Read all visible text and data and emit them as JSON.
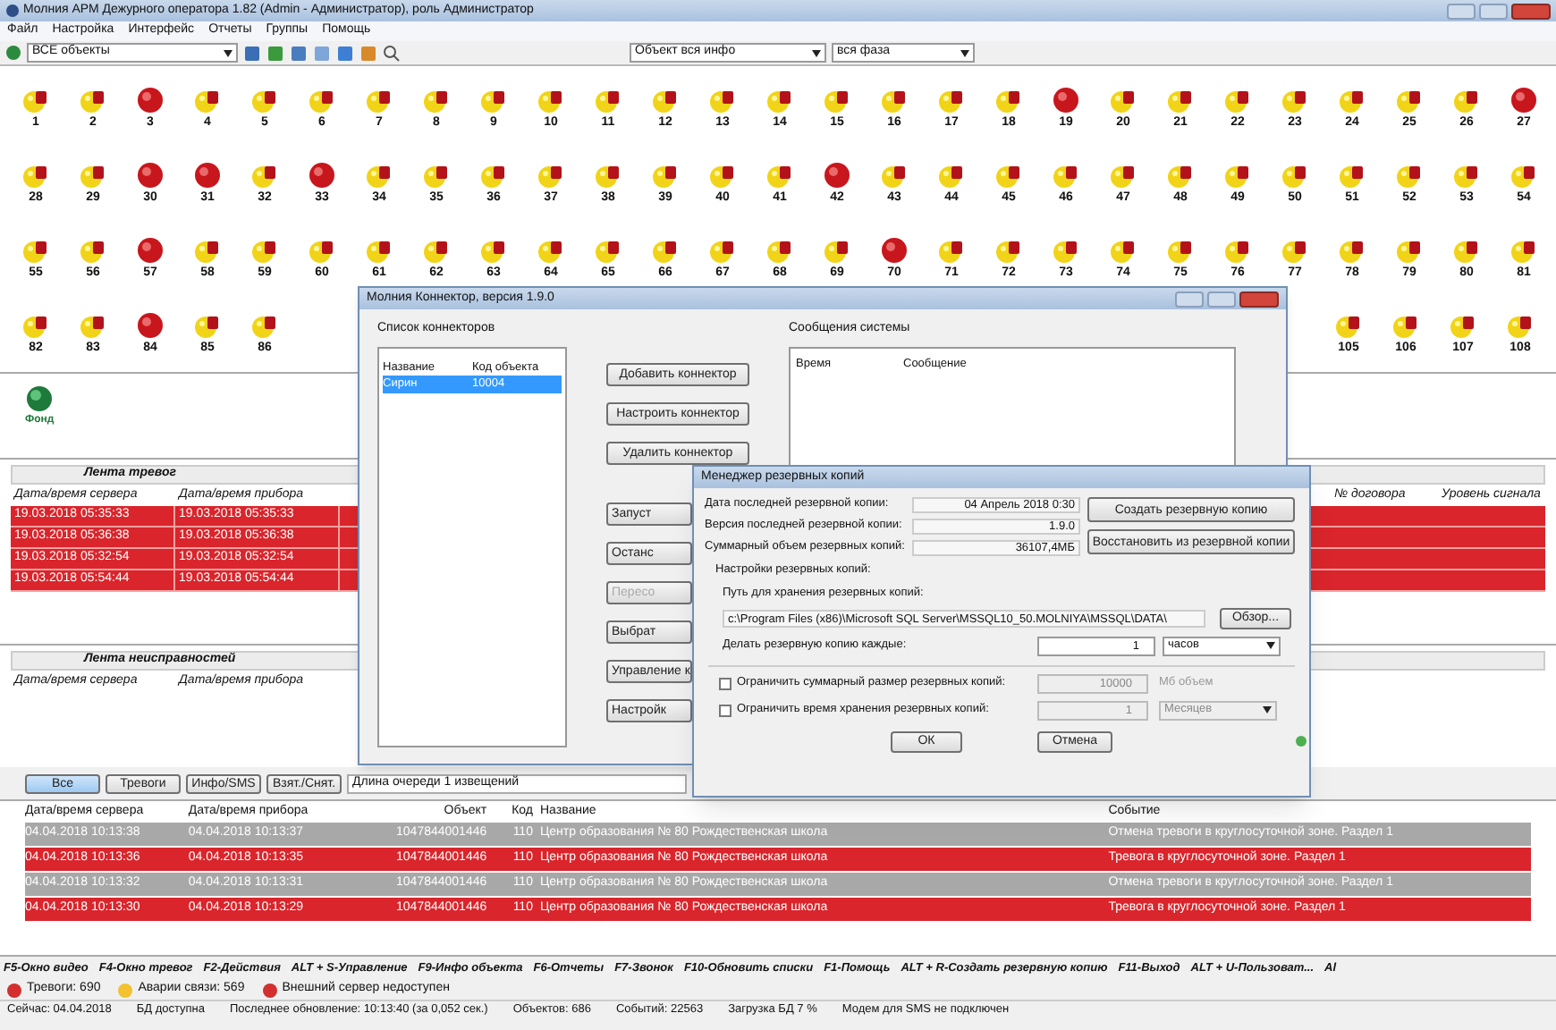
{
  "window": {
    "title": "Молния АРМ Дежурного оператора 1.82 (Admin - Администратор), роль Администратор"
  },
  "menu": [
    "Файл",
    "Настройка",
    "Интерфейс",
    "Отчеты",
    "Группы",
    "Помощь"
  ],
  "toolbar": {
    "objects_filter": "ВСЕ объекты",
    "info_filter": "Объект вся инфо",
    "phase_filter": "вся фаза"
  },
  "object_rows": [
    {
      "left": [
        {
          "label": "1",
          "alarm": false
        },
        {
          "label": "2",
          "alarm": false
        },
        {
          "label": "3",
          "alarm": true
        },
        {
          "label": "4",
          "alarm": false
        },
        {
          "label": "5",
          "alarm": false
        },
        {
          "label": "6",
          "alarm": false
        },
        {
          "label": "7",
          "alarm": false
        },
        {
          "label": "8",
          "alarm": false
        },
        {
          "label": "9",
          "alarm": false
        },
        {
          "label": "10",
          "alarm": false
        },
        {
          "label": "11",
          "alarm": false
        },
        {
          "label": "12",
          "alarm": false
        },
        {
          "label": "13",
          "alarm": false
        },
        {
          "label": "14",
          "alarm": false
        },
        {
          "label": "15",
          "alarm": false
        },
        {
          "label": "16",
          "alarm": false
        },
        {
          "label": "17",
          "alarm": false
        },
        {
          "label": "18",
          "alarm": false
        },
        {
          "label": "19",
          "alarm": true
        },
        {
          "label": "20",
          "alarm": false
        },
        {
          "label": "21",
          "alarm": false
        },
        {
          "label": "22",
          "alarm": false
        },
        {
          "label": "23",
          "alarm": false
        },
        {
          "label": "24",
          "alarm": false
        },
        {
          "label": "25",
          "alarm": false
        },
        {
          "label": "26",
          "alarm": false
        },
        {
          "label": "27",
          "alarm": true
        }
      ]
    },
    {
      "left": [
        {
          "label": "28",
          "alarm": false
        },
        {
          "label": "29",
          "alarm": false
        },
        {
          "label": "30",
          "alarm": true
        },
        {
          "label": "31",
          "alarm": true
        },
        {
          "label": "32",
          "alarm": false
        },
        {
          "label": "33",
          "alarm": true
        },
        {
          "label": "34",
          "alarm": false
        },
        {
          "label": "35",
          "alarm": false
        },
        {
          "label": "36",
          "alarm": false
        },
        {
          "label": "37",
          "alarm": false
        },
        {
          "label": "38",
          "alarm": false
        },
        {
          "label": "39",
          "alarm": false
        },
        {
          "label": "40",
          "alarm": false
        },
        {
          "label": "41",
          "alarm": false
        },
        {
          "label": "42",
          "alarm": true
        },
        {
          "label": "43",
          "alarm": false
        },
        {
          "label": "44",
          "alarm": false
        },
        {
          "label": "45",
          "alarm": false
        },
        {
          "label": "46",
          "alarm": false
        },
        {
          "label": "47",
          "alarm": false
        },
        {
          "label": "48",
          "alarm": false
        },
        {
          "label": "49",
          "alarm": false
        },
        {
          "label": "50",
          "alarm": false
        },
        {
          "label": "51",
          "alarm": false
        },
        {
          "label": "52",
          "alarm": false
        },
        {
          "label": "53",
          "alarm": false
        },
        {
          "label": "54",
          "alarm": false
        }
      ]
    },
    {
      "left": [
        {
          "label": "55",
          "alarm": false
        },
        {
          "label": "56",
          "alarm": false
        },
        {
          "label": "57",
          "alarm": true
        },
        {
          "label": "58",
          "alarm": false
        },
        {
          "label": "59",
          "alarm": false
        },
        {
          "label": "60",
          "alarm": false
        },
        {
          "label": "61",
          "alarm": false
        },
        {
          "label": "62",
          "alarm": false
        },
        {
          "label": "63",
          "alarm": false
        },
        {
          "label": "64",
          "alarm": false
        },
        {
          "label": "65",
          "alarm": false
        },
        {
          "label": "66",
          "alarm": false
        },
        {
          "label": "67",
          "alarm": false
        },
        {
          "label": "68",
          "alarm": false
        },
        {
          "label": "69",
          "alarm": false
        },
        {
          "label": "70",
          "alarm": true
        },
        {
          "label": "71",
          "alarm": false
        },
        {
          "label": "72",
          "alarm": false
        },
        {
          "label": "73",
          "alarm": false
        },
        {
          "label": "74",
          "alarm": false
        },
        {
          "label": "75",
          "alarm": false
        },
        {
          "label": "76",
          "alarm": false
        },
        {
          "label": "77",
          "alarm": false
        },
        {
          "label": "78",
          "alarm": false
        },
        {
          "label": "79",
          "alarm": false
        },
        {
          "label": "80",
          "alarm": false
        },
        {
          "label": "81",
          "alarm": false
        }
      ]
    },
    {
      "left": [
        {
          "label": "82",
          "alarm": false
        },
        {
          "label": "83",
          "alarm": false
        },
        {
          "label": "84",
          "alarm": true
        },
        {
          "label": "85",
          "alarm": false
        },
        {
          "label": "86",
          "alarm": false
        }
      ],
      "right": [
        {
          "label": "105",
          "alarm": false
        },
        {
          "label": "106",
          "alarm": false
        },
        {
          "label": "107",
          "alarm": false
        },
        {
          "label": "108",
          "alarm": false
        }
      ]
    }
  ],
  "group_icon": {
    "label": "Фонд"
  },
  "alarm_feed": {
    "title": "Лента тревог",
    "columns": [
      "Дата/время сервера",
      "Дата/время прибора"
    ],
    "right_columns": [
      "№ договора",
      "Уровень сигнала"
    ],
    "rows": [
      [
        "19.03.2018  05:35:33",
        "19.03.2018  05:35:33"
      ],
      [
        "19.03.2018  05:36:38",
        "19.03.2018  05:36:38"
      ],
      [
        "19.03.2018  05:32:54",
        "19.03.2018  05:32:54"
      ],
      [
        "19.03.2018  05:54:44",
        "19.03.2018  05:54:44"
      ]
    ]
  },
  "fault_feed": {
    "title": "Лента неисправностей",
    "columns": [
      "Дата/время сервера",
      "Дата/время прибора"
    ]
  },
  "filter_buttons": [
    {
      "label": "Все",
      "selected": true
    },
    {
      "label": "Тревоги",
      "selected": false
    },
    {
      "label": "Инфо/SMS",
      "selected": false
    },
    {
      "label": "Взят./Снят.",
      "selected": false
    }
  ],
  "queue_length": "Длина очереди 1 извещений",
  "events": {
    "columns": [
      "Дата/время сервера",
      "Дата/время прибора",
      "Объект",
      "Код",
      "Название",
      "Событие"
    ],
    "rows": [
      {
        "kind": "cancel",
        "cells": [
          "04.04.2018  10:13:38",
          "04.04.2018  10:13:37",
          "1047844001446",
          "110",
          "Центр образования № 80 Рождественская школа",
          "Отмена тревоги в круглосуточной зоне. Раздел 1"
        ]
      },
      {
        "kind": "alarm",
        "cells": [
          "04.04.2018  10:13:36",
          "04.04.2018  10:13:35",
          "1047844001446",
          "110",
          "Центр образования № 80 Рождественская школа",
          "Тревога в круглосуточной зоне. Раздел 1"
        ]
      },
      {
        "kind": "cancel",
        "cells": [
          "04.04.2018  10:13:32",
          "04.04.2018  10:13:31",
          "1047844001446",
          "110",
          "Центр образования № 80 Рождественская школа",
          "Отмена тревоги в круглосуточной зоне. Раздел 1"
        ]
      },
      {
        "kind": "alarm",
        "cells": [
          "04.04.2018  10:13:30",
          "04.04.2018  10:13:29",
          "1047844001446",
          "110",
          "Центр образования № 80 Рождественская школа",
          "Тревога в круглосуточной зоне. Раздел 1"
        ]
      }
    ]
  },
  "hotkeys": [
    "F5-Окно видео",
    "F4-Окно тревог",
    "F2-Действия",
    "ALT + S-Управление",
    "F9-Инфо объекта",
    "F6-Отчеты",
    "F7-Звонок",
    "F10-Обновить списки",
    "F1-Помощь",
    "ALT + R-Создать резервную копию",
    "F11-Выход",
    "ALT + U-Пользоват...",
    "Al"
  ],
  "indicators": [
    {
      "label": "Тревоги: 690",
      "color": "#d32f2f"
    },
    {
      "label": "Аварии связи: 569",
      "color": "#f2c230"
    },
    {
      "label": "Внешний сервер недоступен",
      "color": "#d32f2f"
    }
  ],
  "status_bar": [
    "Сейчас: 04.04.2018",
    "БД доступна",
    "Последнее обновление: 10:13:40 (за 0,052 сек.)",
    "Объектов: 686",
    "Событий: 22563",
    "Загрузка БД 7 %",
    "Модем для SMS не подключен"
  ],
  "connector_dialog": {
    "title": "Молния Коннектор, версия 1.9.0",
    "list_label": "Список коннекторов",
    "list_columns": [
      "Название",
      "Код объекта"
    ],
    "connectors": [
      {
        "name": "Сирин",
        "code": "10004",
        "selected": true
      }
    ],
    "buttons": [
      {
        "label": "Добавить коннектор",
        "disabled": false
      },
      {
        "label": "Настроить коннектор",
        "disabled": false
      },
      {
        "label": "Удалить коннектор",
        "disabled": false
      }
    ],
    "lower_buttons": [
      {
        "label": "Запуст",
        "disabled": false
      },
      {
        "label": "Останс",
        "disabled": false
      },
      {
        "label": "Пересо",
        "disabled": true
      },
      {
        "label": "Выбрат",
        "disabled": false
      },
      {
        "label": "Управление к",
        "disabled": false
      },
      {
        "label": "Настройк",
        "disabled": false
      }
    ],
    "messages_label": "Сообщения системы",
    "message_columns": [
      "Время",
      "Сообщение"
    ]
  },
  "backup_dialog": {
    "title": "Менеджер резервных копий",
    "info": [
      {
        "label": "Дата последней резервной копии:",
        "value": "04 Апрель 2018 0:30"
      },
      {
        "label": "Версия последней резервной копии:",
        "value": "1.9.0"
      },
      {
        "label": "Суммарный объем резервных копий:",
        "value": "36107,4МБ"
      }
    ],
    "create_button": "Создать резервную копию",
    "restore_button": "Восстановить из резервной копии",
    "settings_label": "Настройки резервных копий:",
    "path_label": "Путь для хранения резервных копий:",
    "path": "c:\\Program Files (x86)\\Microsoft SQL Server\\MSSQL10_50.MOLNIYA\\MSSQL\\DATA\\",
    "browse_button": "Обзор...",
    "interval_label": "Делать резервную копию каждые:",
    "interval": "1",
    "interval_unit": "часов",
    "limits": [
      {
        "label": "Ограничить суммарный размер резервных копий:",
        "checked": false,
        "value": "10000",
        "unit": "Мб объем",
        "kind": "text"
      },
      {
        "label": "Ограничить время хранения резервных копий:",
        "checked": false,
        "value": "1",
        "unit": "Месяцев",
        "kind": "select"
      }
    ],
    "ok": "ОК",
    "cancel": "Отмена"
  }
}
